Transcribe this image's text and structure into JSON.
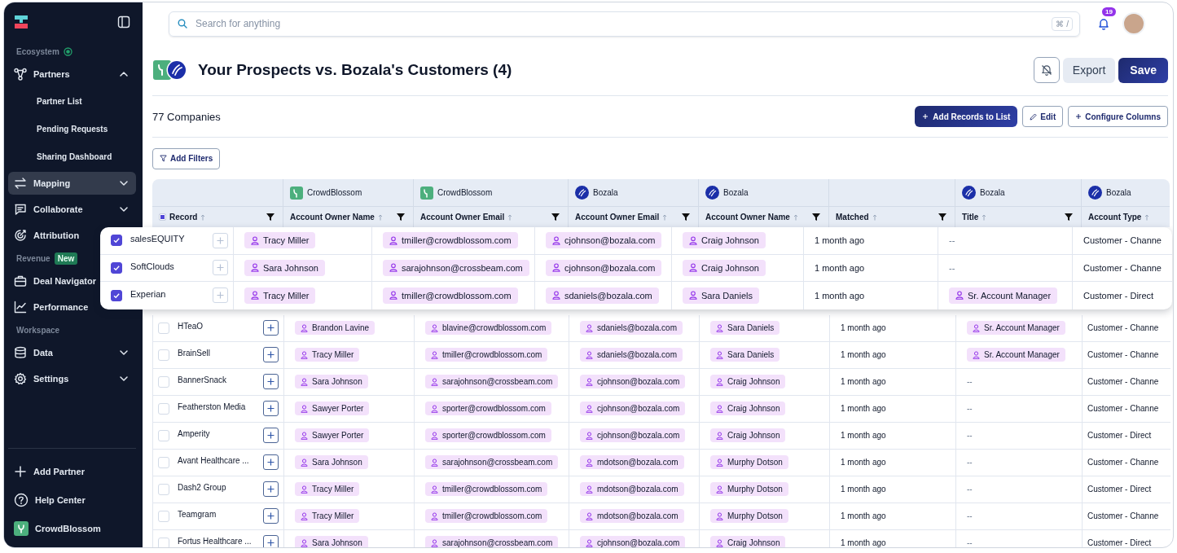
{
  "sidebar": {
    "sections": [
      {
        "label": "Ecosystem",
        "items": [
          {
            "label": "Partners",
            "kind": "group",
            "expanded": true,
            "selected": false,
            "children": [
              {
                "label": "Partner List"
              },
              {
                "label": "Pending Requests"
              },
              {
                "label": "Sharing Dashboard"
              }
            ]
          },
          {
            "label": "Mapping",
            "kind": "group",
            "expanded": false,
            "selected": true
          },
          {
            "label": "Collaborate",
            "kind": "group",
            "expanded": false,
            "selected": false
          },
          {
            "label": "Attribution",
            "kind": "link",
            "selected": false
          }
        ]
      },
      {
        "label": "Revenue",
        "badge": "New",
        "items": [
          {
            "label": "Deal Navigator",
            "kind": "link",
            "selected": false
          },
          {
            "label": "Performance",
            "kind": "link",
            "selected": false
          }
        ]
      },
      {
        "label": "Workspace",
        "items": [
          {
            "label": "Data",
            "kind": "group",
            "expanded": false,
            "selected": false
          },
          {
            "label": "Settings",
            "kind": "group",
            "expanded": false,
            "selected": false
          }
        ]
      }
    ],
    "footer": [
      {
        "label": "Add Partner"
      },
      {
        "label": "Help Center"
      },
      {
        "label": "CrowdBlossom"
      }
    ]
  },
  "topbar": {
    "search": {
      "placeholder": "Search for anything",
      "shortcut": "⌘ /"
    },
    "notifications": "19"
  },
  "page": {
    "title": "Your Prospects vs. Bozala's Customers (4)",
    "actions": [
      "Export",
      "Save"
    ],
    "count": "77 Companies",
    "list_actions": [
      "Add Records to List",
      "Edit",
      "Configure Columns"
    ],
    "filter_button": "Add Filters"
  },
  "table": {
    "select_all": {
      "indeterminate": true
    },
    "columns": [
      {
        "kind": "none",
        "label": "Record",
        "filter": true
      },
      {
        "source": "CrowdBlossom",
        "kind": "own",
        "label": "Account Owner Name",
        "filter": true
      },
      {
        "source": "CrowdBlossom",
        "kind": "own",
        "label": "Account Owner Email",
        "filter": true
      },
      {
        "source": "Bozala",
        "kind": "partner",
        "label": "Account Owner Email",
        "filter": true
      },
      {
        "source": "Bozala",
        "kind": "partner",
        "label": "Account Owner Name",
        "filter": true
      },
      {
        "kind": "none",
        "label": "Matched",
        "filter": true
      },
      {
        "source": "Bozala",
        "kind": "partner",
        "label": "Title",
        "filter": true
      },
      {
        "source": "Bozala",
        "kind": "partner",
        "label": "Account Type",
        "filter": false
      }
    ],
    "rows": [
      {
        "selected": true,
        "cells": [
          {
            "kind": "record",
            "text": "salesEQUITY"
          },
          {
            "kind": "chip",
            "text": "Tracy Miller"
          },
          {
            "kind": "chip",
            "text": "tmiller@crowdblossom.com"
          },
          {
            "kind": "chip",
            "text": "cjohnson@bozala.com"
          },
          {
            "kind": "chip",
            "text": "Craig Johnson"
          },
          {
            "kind": "text",
            "text": "1 month ago"
          },
          {
            "kind": "empty",
            "text": "--"
          },
          {
            "kind": "text",
            "text": "Customer - Channe"
          }
        ]
      },
      {
        "selected": true,
        "cells": [
          {
            "kind": "record",
            "text": "SoftClouds"
          },
          {
            "kind": "chip",
            "text": "Sara Johnson"
          },
          {
            "kind": "chip",
            "text": "sarajohnson@crossbeam.com"
          },
          {
            "kind": "chip",
            "text": "cjohnson@bozala.com"
          },
          {
            "kind": "chip",
            "text": "Craig Johnson"
          },
          {
            "kind": "text",
            "text": "1 month ago"
          },
          {
            "kind": "empty",
            "text": "--"
          },
          {
            "kind": "text",
            "text": "Customer - Channe"
          }
        ]
      },
      {
        "selected": true,
        "cells": [
          {
            "kind": "record",
            "text": "Experian"
          },
          {
            "kind": "chip",
            "text": "Tracy Miller"
          },
          {
            "kind": "chip",
            "text": "tmiller@crowdblossom.com"
          },
          {
            "kind": "chip",
            "text": "sdaniels@bozala.com"
          },
          {
            "kind": "chip",
            "text": "Sara Daniels"
          },
          {
            "kind": "text",
            "text": "1 month ago"
          },
          {
            "kind": "chip",
            "text": "Sr. Account Manager"
          },
          {
            "kind": "text",
            "text": "Customer - Direct"
          }
        ]
      },
      {
        "selected": false,
        "cells": [
          {
            "kind": "record",
            "text": "HTeaO"
          },
          {
            "kind": "chip",
            "text": "Brandon Lavine"
          },
          {
            "kind": "chip",
            "text": "blavine@crowdblossom.com"
          },
          {
            "kind": "chip",
            "text": "sdaniels@bozala.com"
          },
          {
            "kind": "chip",
            "text": "Sara Daniels"
          },
          {
            "kind": "text",
            "text": "1 month ago"
          },
          {
            "kind": "chip",
            "text": "Sr. Account Manager"
          },
          {
            "kind": "text",
            "text": "Customer - Channe"
          }
        ]
      },
      {
        "selected": false,
        "cells": [
          {
            "kind": "record",
            "text": "BrainSell"
          },
          {
            "kind": "chip",
            "text": "Tracy Miller"
          },
          {
            "kind": "chip",
            "text": "tmiller@crowdblossom.com"
          },
          {
            "kind": "chip",
            "text": "sdaniels@bozala.com"
          },
          {
            "kind": "chip",
            "text": "Sara Daniels"
          },
          {
            "kind": "text",
            "text": "1 month ago"
          },
          {
            "kind": "chip",
            "text": "Sr. Account Manager"
          },
          {
            "kind": "text",
            "text": "Customer - Channe"
          }
        ]
      },
      {
        "selected": false,
        "cells": [
          {
            "kind": "record",
            "text": "BannerSnack"
          },
          {
            "kind": "chip",
            "text": "Sara Johnson"
          },
          {
            "kind": "chip",
            "text": "sarajohnson@crossbeam.com"
          },
          {
            "kind": "chip",
            "text": "cjohnson@bozala.com"
          },
          {
            "kind": "chip",
            "text": "Craig Johnson"
          },
          {
            "kind": "text",
            "text": "1 month ago"
          },
          {
            "kind": "empty",
            "text": "--"
          },
          {
            "kind": "text",
            "text": "Customer - Channe"
          }
        ]
      },
      {
        "selected": false,
        "cells": [
          {
            "kind": "record",
            "text": "Featherston Media"
          },
          {
            "kind": "chip",
            "text": "Sawyer Porter"
          },
          {
            "kind": "chip",
            "text": "sporter@crowdblossom.com"
          },
          {
            "kind": "chip",
            "text": "cjohnson@bozala.com"
          },
          {
            "kind": "chip",
            "text": "Craig Johnson"
          },
          {
            "kind": "text",
            "text": "1 month ago"
          },
          {
            "kind": "empty",
            "text": "--"
          },
          {
            "kind": "text",
            "text": "Customer - Channe"
          }
        ]
      },
      {
        "selected": false,
        "cells": [
          {
            "kind": "record",
            "text": "Amperity"
          },
          {
            "kind": "chip",
            "text": "Sawyer Porter"
          },
          {
            "kind": "chip",
            "text": "sporter@crowdblossom.com"
          },
          {
            "kind": "chip",
            "text": "cjohnson@bozala.com"
          },
          {
            "kind": "chip",
            "text": "Craig Johnson"
          },
          {
            "kind": "text",
            "text": "1 month ago"
          },
          {
            "kind": "empty",
            "text": "--"
          },
          {
            "kind": "text",
            "text": "Customer - Direct"
          }
        ]
      },
      {
        "selected": false,
        "cells": [
          {
            "kind": "record",
            "text": "Avant Healthcare ..."
          },
          {
            "kind": "chip",
            "text": "Sara Johnson"
          },
          {
            "kind": "chip",
            "text": "sarajohnson@crossbeam.com"
          },
          {
            "kind": "chip",
            "text": "mdotson@bozala.com"
          },
          {
            "kind": "chip",
            "text": "Murphy Dotson"
          },
          {
            "kind": "text",
            "text": "1 month ago"
          },
          {
            "kind": "empty",
            "text": "--"
          },
          {
            "kind": "text",
            "text": "Customer - Channe"
          }
        ]
      },
      {
        "selected": false,
        "cells": [
          {
            "kind": "record",
            "text": "Dash2 Group"
          },
          {
            "kind": "chip",
            "text": "Tracy Miller"
          },
          {
            "kind": "chip",
            "text": "tmiller@crowdblossom.com"
          },
          {
            "kind": "chip",
            "text": "mdotson@bozala.com"
          },
          {
            "kind": "chip",
            "text": "Murphy Dotson"
          },
          {
            "kind": "text",
            "text": "1 month ago"
          },
          {
            "kind": "empty",
            "text": "--"
          },
          {
            "kind": "text",
            "text": "Customer - Direct"
          }
        ]
      },
      {
        "selected": false,
        "cells": [
          {
            "kind": "record",
            "text": "Teamgram"
          },
          {
            "kind": "chip",
            "text": "Tracy Miller"
          },
          {
            "kind": "chip",
            "text": "tmiller@crowdblossom.com"
          },
          {
            "kind": "chip",
            "text": "mdotson@bozala.com"
          },
          {
            "kind": "chip",
            "text": "Murphy Dotson"
          },
          {
            "kind": "text",
            "text": "1 month ago"
          },
          {
            "kind": "empty",
            "text": "--"
          },
          {
            "kind": "text",
            "text": "Customer - Channe"
          }
        ]
      },
      {
        "selected": false,
        "cells": [
          {
            "kind": "record",
            "text": "Fortus Healthcare ..."
          },
          {
            "kind": "chip",
            "text": "Sara Johnson"
          },
          {
            "kind": "chip",
            "text": "sarajohnson@crossbeam.com"
          },
          {
            "kind": "chip",
            "text": "cjohnson@bozala.com"
          },
          {
            "kind": "chip",
            "text": "Craig Johnson"
          },
          {
            "kind": "text",
            "text": "1 month ago"
          },
          {
            "kind": "empty",
            "text": "--"
          },
          {
            "kind": "text",
            "text": "Customer - Direct"
          }
        ]
      }
    ]
  }
}
